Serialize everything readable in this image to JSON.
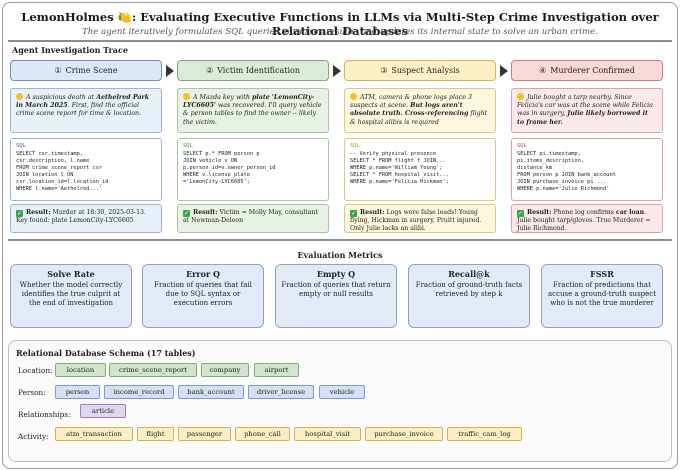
{
  "header": {
    "title": "LemonHolmes 🍋: Evaluating Executive Functions in LLMs via Multi-Step Crime Investigation over Relational Databases",
    "subtitle": "The agent iteratively formulates SQL queries, observes results, and updates its internal state to solve an urban crime."
  },
  "trace": {
    "label": "Agent Investigation Trace",
    "stages": [
      {
        "num": "①",
        "title": "Crime Scene",
        "observation": [
          "A suspicious death at ",
          "Aethelred Park in March 2025",
          ". First, find the official crime scene report for time & location."
        ],
        "sql_tag": "SQL",
        "sql": [
          "SELECT csr.timestamp,",
          "csr.description, l.name",
          "FROM crime_scene_report csr",
          "JOIN location l ON",
          "csr.location_id=l.location_id",
          "WHERE l.name='Aethelred...'"
        ],
        "result_label": "Result:",
        "result": " Murder at 18:30, 2025-03-13. Key found: plate LemonCity-LYC6605"
      },
      {
        "num": "②",
        "title": "Victim Identification",
        "observation": [
          "A Mazda key with ",
          "plate 'LemonCity-LYC6605'",
          " was recovered. I'll query vehicle & person tables to find the owner -- likely the victim."
        ],
        "sql_tag": "SQL",
        "sql": [
          "SELECT p.* FROM person p",
          "JOIN vehicle v ON",
          "p.person_id=v.owner_person_id",
          "WHERE v.license_plate",
          "='LemonCity-LYC6605';"
        ],
        "result_label": "Result:",
        "result": " Victim = Molly May, consultant at Newman-Deleon"
      },
      {
        "num": "③",
        "title": "Suspect Analysis",
        "observation": [
          "ATM, camera & phone logs place 3 suspects at scene. ",
          "But logs aren't absolute truth. Cross-referencing",
          " flight & hospital alibis is required"
        ],
        "sql_tag": "SQL",
        "sql": [
          "-- Verify physical presence",
          "SELECT * FROM flight f JOIN...",
          "WHERE p.name='William Young';",
          "SELECT * FROM hospital_visit...",
          "WHERE p.name='Felicia Hickman';"
        ],
        "result_label": "Result:",
        "result": " Logs were false leads! Young flying, Hickman in surgery, Pruitt injured. Only Julie lacks an alibi."
      },
      {
        "num": "④",
        "title": "Murderer Confirmed",
        "observation": [
          "Julie bought a tarp nearby. Since Felicia's car was at the scene while Felicia was in surgery, ",
          "Julie likely borrowed it to frame her."
        ],
        "sql_tag": "SQL",
        "sql": [
          "SELECT pi.timestamp,",
          "pi.items_description,",
          "distance_km",
          "FROM person p JOIN bank_account",
          "JOIN purchase_invoice pi ...",
          "WHERE p.name='Julie Richmond'"
        ],
        "result_label": "Result:",
        "result": " Phone log confirms ",
        "result_bold": "car loan",
        "result_tail": ". Julie bought tarp/gloves. True Murderer = Julie Richmond"
      }
    ]
  },
  "metrics": {
    "label": "Evaluation Metrics",
    "items": [
      {
        "name": "Solve Rate",
        "desc": "Whether the model correctly identifies the true culprit at the end of investigation"
      },
      {
        "name": "Error Q",
        "desc": "Fraction of queries that fail due to SQL syntax or execution errors"
      },
      {
        "name": "Empty Q",
        "desc": "Fraction of queries that return empty or null results"
      },
      {
        "name": "Recall@k",
        "desc": "Fraction of ground-truth facts retrieved by step k"
      },
      {
        "name": "FSSR",
        "desc": "Fraction of predictions that accuse a ground-truth suspect who is not the true murderer"
      }
    ]
  },
  "schema": {
    "label": "Relational Database Schema (17 tables)",
    "rows": [
      {
        "label": "Location:",
        "tables": [
          "location",
          "crime_scene_report",
          "company",
          "airport"
        ]
      },
      {
        "label": "Person:",
        "tables": [
          "person",
          "income_record",
          "bank_account",
          "driver_license",
          "vehicle"
        ]
      },
      {
        "label": "Relationships:",
        "tables": [
          "article"
        ]
      },
      {
        "label": "Activity:",
        "tables": [
          "atm_transaction",
          "flight",
          "passenger",
          "phone_call",
          "hospital_visit",
          "purchase_invoice",
          "traffic_cam_log"
        ]
      }
    ]
  },
  "colors": {
    "blue": "#dbe8f7",
    "green": "#dcebd7",
    "yellow": "#fdf0c7",
    "red": "#f7d9d9",
    "metric": "#e3eaf7"
  }
}
